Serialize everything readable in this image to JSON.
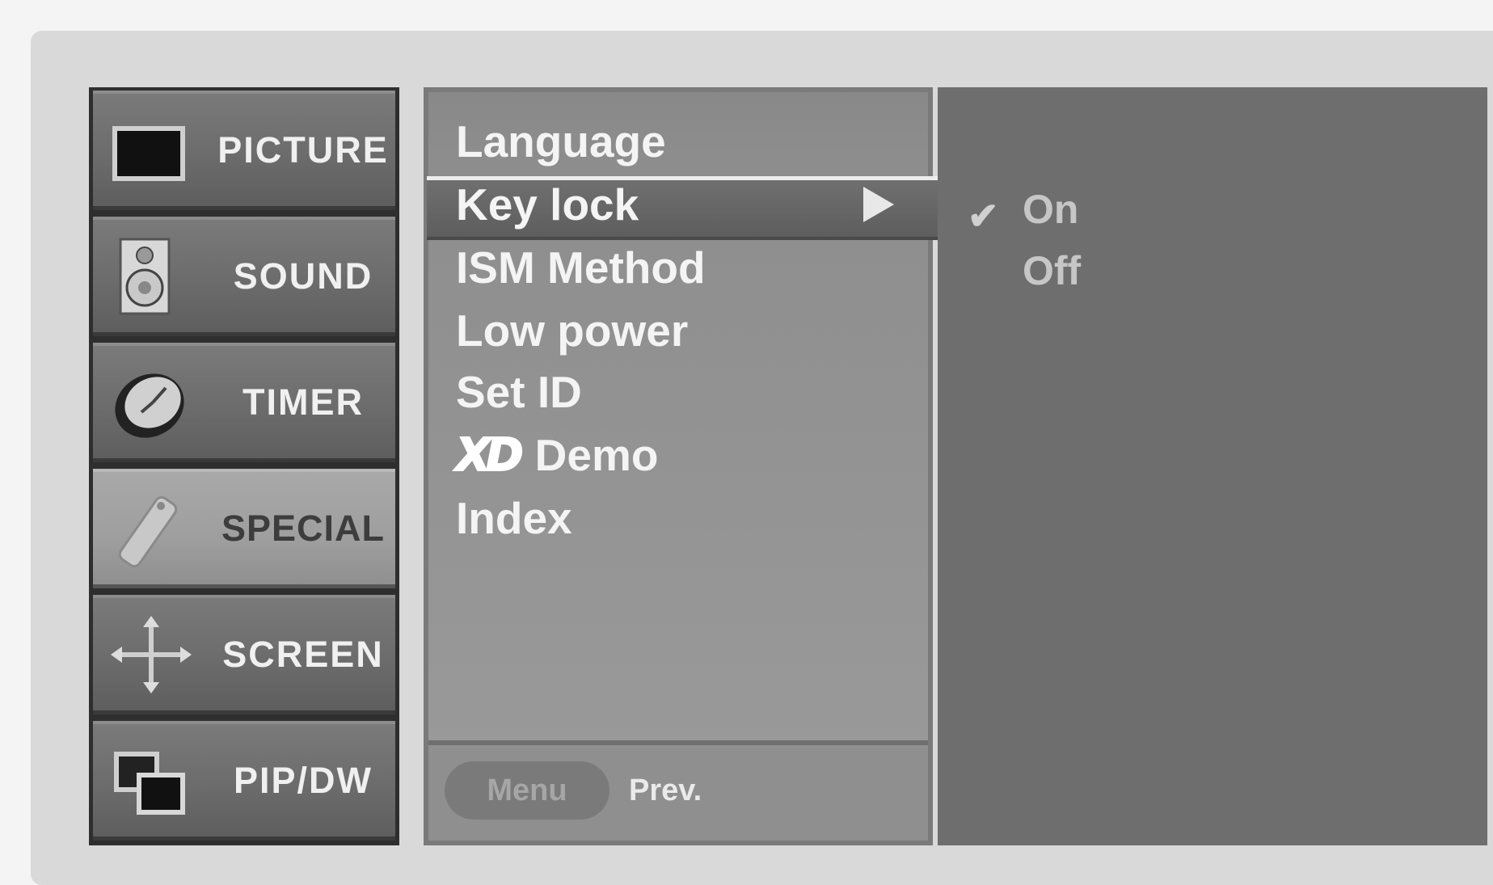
{
  "categories": [
    {
      "label": "PICTURE",
      "icon": "picture-icon"
    },
    {
      "label": "SOUND",
      "icon": "speaker-icon"
    },
    {
      "label": "TIMER",
      "icon": "clock-icon"
    },
    {
      "label": "SPECIAL",
      "icon": "remote-control-icon",
      "selected": true
    },
    {
      "label": "SCREEN",
      "icon": "move-arrows-icon"
    },
    {
      "label": "PIP/DW",
      "icon": "pip-windows-icon"
    }
  ],
  "options": {
    "items": [
      "Language",
      "Key lock",
      "ISM Method",
      "Low power",
      "Set ID",
      "Demo",
      "Index"
    ],
    "highlighted": "Key lock",
    "xd_logo": "XD"
  },
  "values": {
    "on": "On",
    "off": "Off",
    "checked": "On"
  },
  "footer": {
    "menu_button": "Menu",
    "prev_label": "Prev."
  }
}
